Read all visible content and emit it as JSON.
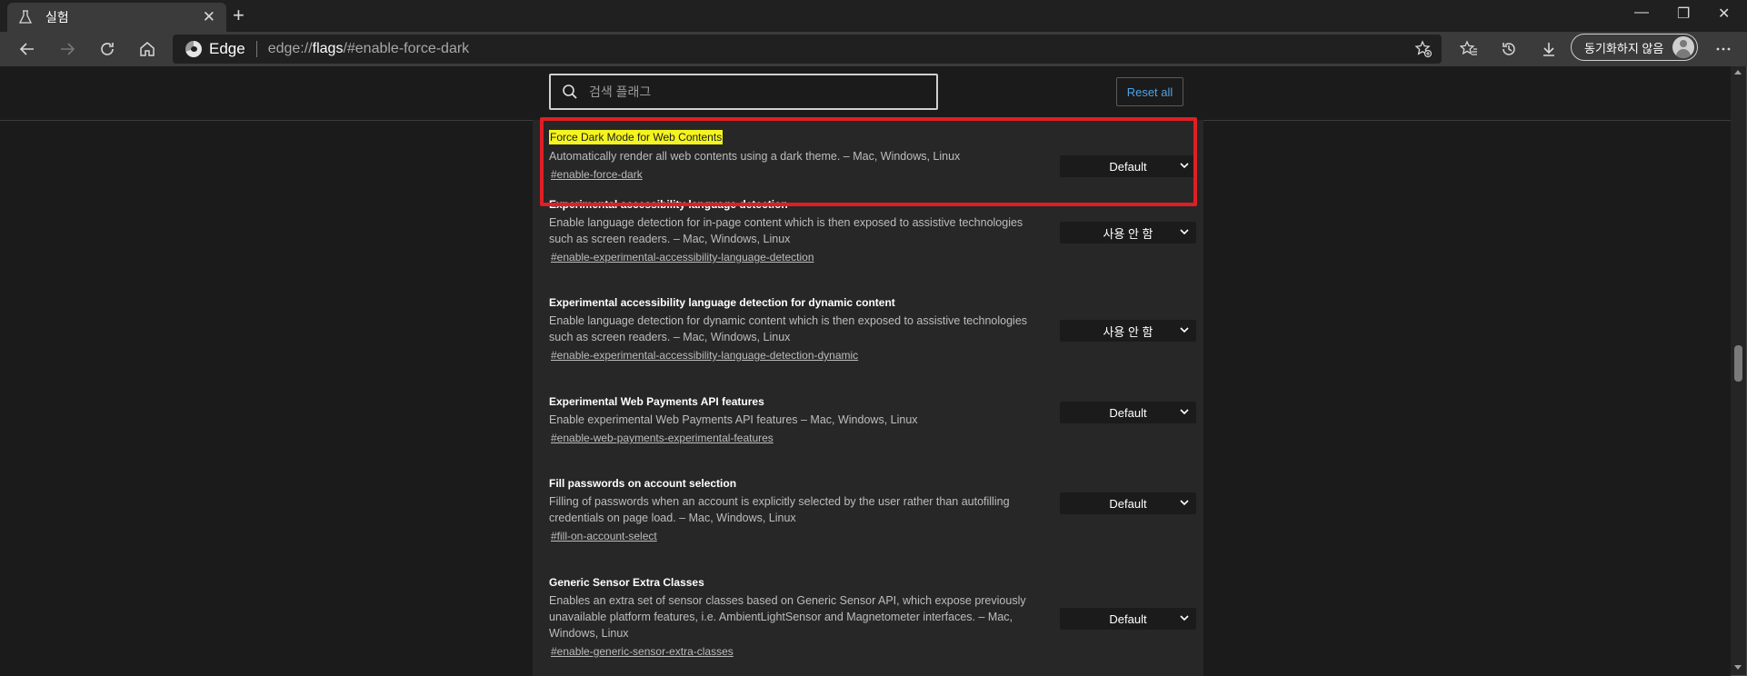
{
  "tab": {
    "title": "실험",
    "icon": "flask-icon"
  },
  "window": {
    "minimize": "—",
    "restore": "❐",
    "close": "✕"
  },
  "toolbar": {
    "brand": "Edge",
    "url_prefix": "edge://",
    "url_strong": "flags",
    "url_suffix": "/#enable-force-dark",
    "profile_label": "동기화하지 않음"
  },
  "search": {
    "placeholder": "검색 플래그",
    "value": ""
  },
  "reset_label": "Reset all",
  "flags": [
    {
      "name": "Force Dark Mode for Web Contents",
      "description": "Automatically render all web contents using a dark theme. – Mac, Windows, Linux",
      "link": "#enable-force-dark",
      "value": "Default",
      "highlighted": true
    },
    {
      "name": "Experimental accessibility language detection",
      "description": "Enable language detection for in-page content which is then exposed to assistive technologies such as screen readers. – Mac, Windows, Linux",
      "link": "#enable-experimental-accessibility-language-detection",
      "value": "사용 안 함"
    },
    {
      "name": "Experimental accessibility language detection for dynamic content",
      "description": "Enable language detection for dynamic content which is then exposed to assistive technologies such as screen readers. – Mac, Windows, Linux",
      "link": "#enable-experimental-accessibility-language-detection-dynamic",
      "value": "사용 안 함"
    },
    {
      "name": "Experimental Web Payments API features",
      "description": "Enable experimental Web Payments API features – Mac, Windows, Linux",
      "link": "#enable-web-payments-experimental-features",
      "value": "Default"
    },
    {
      "name": "Fill passwords on account selection",
      "description": "Filling of passwords when an account is explicitly selected by the user rather than autofilling credentials on page load. – Mac, Windows, Linux",
      "link": "#fill-on-account-select",
      "value": "Default"
    },
    {
      "name": "Generic Sensor Extra Classes",
      "description": "Enables an extra set of sensor classes based on Generic Sensor API, which expose previously unavailable platform features, i.e. AmbientLightSensor and Magnetometer interfaces. – Mac, Windows, Linux",
      "link": "#enable-generic-sensor-extra-classes",
      "value": "Default"
    }
  ]
}
